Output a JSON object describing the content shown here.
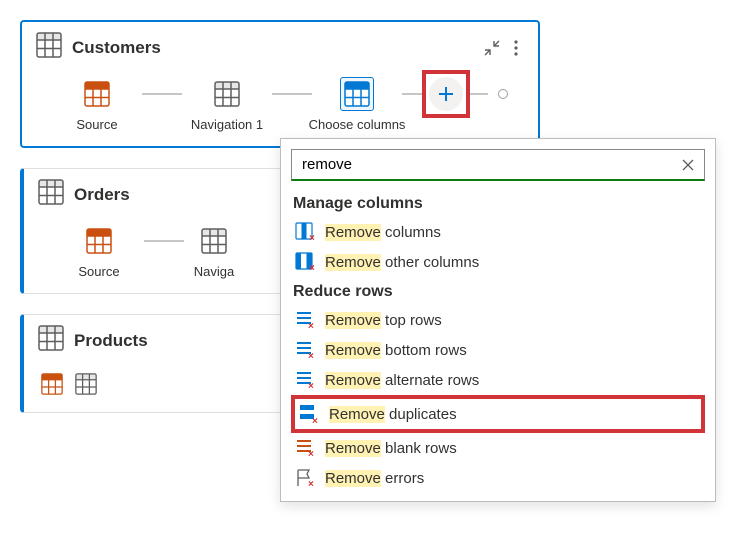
{
  "queries": {
    "customers": {
      "title": "Customers",
      "steps": {
        "s1": "Source",
        "s2": "Navigation 1",
        "s3": "Choose columns"
      }
    },
    "orders": {
      "title": "Orders",
      "steps": {
        "s1": "Source",
        "s2": "Naviga"
      }
    },
    "products": {
      "title": "Products"
    }
  },
  "search": {
    "value": "remove",
    "groups": {
      "g1": {
        "title": "Manage columns",
        "items": {
          "i1": {
            "hl": "Remove",
            "rest": " columns"
          },
          "i2": {
            "hl": "Remove",
            "rest": " other columns"
          }
        }
      },
      "g2": {
        "title": "Reduce rows",
        "items": {
          "i1": {
            "hl": "Remove",
            "rest": " top rows"
          },
          "i2": {
            "hl": "Remove",
            "rest": " bottom rows"
          },
          "i3": {
            "hl": "Remove",
            "rest": " alternate rows"
          },
          "i4": {
            "hl": "Remove",
            "rest": " duplicates"
          },
          "i5": {
            "hl": "Remove",
            "rest": " blank rows"
          },
          "i6": {
            "hl": "Remove",
            "rest": " errors"
          }
        }
      }
    }
  }
}
